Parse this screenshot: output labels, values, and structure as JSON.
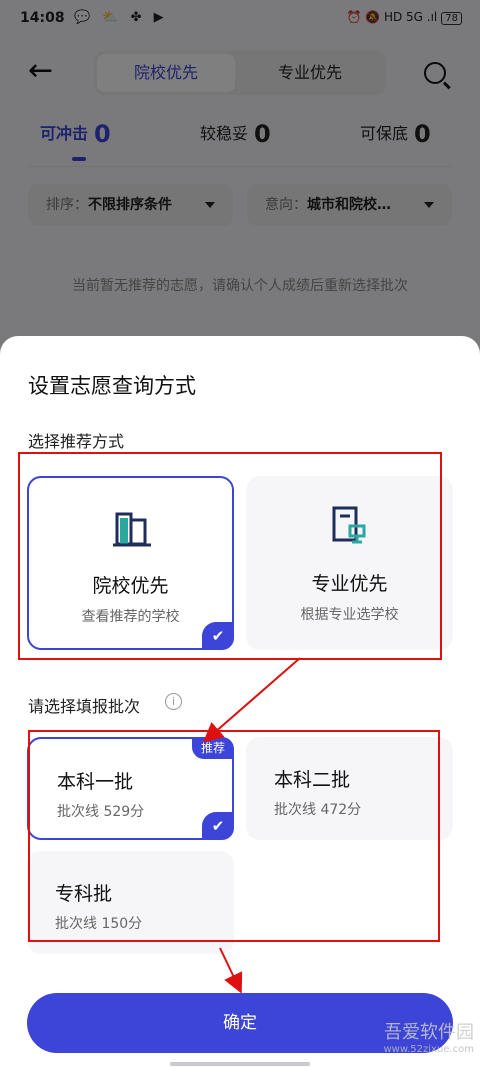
{
  "status": {
    "time": "14:08",
    "notif_icons": "💬 ⛅ ✤ ▶",
    "right_icons": "⏰ 🔕 HD 5G .ıl",
    "battery": "78"
  },
  "header": {
    "tab_school": "院校优先",
    "tab_major": "专业优先"
  },
  "stats": [
    {
      "label": "可冲击",
      "count": "0"
    },
    {
      "label": "较稳妥",
      "count": "0"
    },
    {
      "label": "可保底",
      "count": "0"
    }
  ],
  "filters": {
    "sort_key": "排序：",
    "sort_value": "不限排序条件",
    "intent_key": "意向：",
    "intent_value": "城市和院校…"
  },
  "empty_text": "当前暂无推荐的志愿，请确认个人成绩后重新选择批次",
  "sheet": {
    "title": "设置志愿查询方式",
    "method_label": "选择推荐方式",
    "methods": [
      {
        "title": "院校优先",
        "sub": "查看推荐的学校"
      },
      {
        "title": "专业优先",
        "sub": "根据专业选学校"
      }
    ],
    "batch_label": "请选择填报批次",
    "batches": [
      {
        "title": "本科一批",
        "sub": "批次线 529分",
        "badge": "推荐"
      },
      {
        "title": "本科二批",
        "sub": "批次线 472分"
      },
      {
        "title": "专科批",
        "sub": "批次线 150分"
      }
    ],
    "confirm_label": "确定"
  },
  "watermark": {
    "main": "吾爱软件园",
    "url": "www.52zixue.com"
  },
  "colors": {
    "accent": "#3c45d8",
    "annotation": "#e01010"
  }
}
